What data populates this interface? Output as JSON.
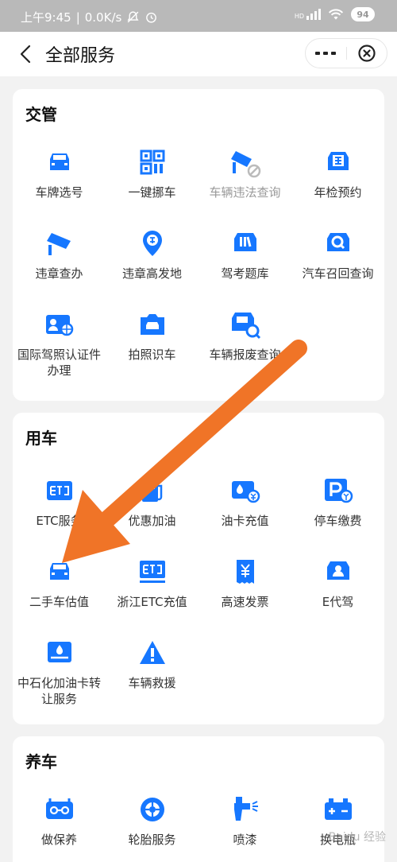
{
  "status_bar": {
    "time": "上午9:45",
    "separator": "|",
    "speed": "0.0K/s",
    "signal": "HD",
    "battery": "94"
  },
  "header": {
    "title": "全部服务",
    "more_icon": "more-icon",
    "close_icon": "close-circle-icon"
  },
  "sections": {
    "jiaoguan": {
      "title": "交管",
      "items": [
        {
          "label": "车牌选号",
          "icon": "car-front-icon"
        },
        {
          "label": "一键挪车",
          "icon": "qr-code-icon"
        },
        {
          "label": "车辆违法查询",
          "icon": "camera-disabled-icon"
        },
        {
          "label": "年检预约",
          "icon": "car-inspection-icon"
        },
        {
          "label": "违章查办",
          "icon": "surveillance-camera-icon"
        },
        {
          "label": "违章高发地",
          "icon": "location-pin-icon"
        },
        {
          "label": "驾考题库",
          "icon": "book-car-icon"
        },
        {
          "label": "汽车召回查询",
          "icon": "car-search-icon"
        },
        {
          "label": "国际驾照认证件办理",
          "icon": "license-card-icon"
        },
        {
          "label": "拍照识车",
          "icon": "camera-car-icon"
        },
        {
          "label": "车辆报废查询",
          "icon": "scrap-search-icon"
        }
      ]
    },
    "yongche": {
      "title": "用车",
      "items": [
        {
          "label": "ETC服务",
          "icon": "etc-card-icon"
        },
        {
          "label": "优惠加油",
          "icon": "coupon-fuel-icon"
        },
        {
          "label": "油卡充值",
          "icon": "fuel-card-icon"
        },
        {
          "label": "停车缴费",
          "icon": "parking-icon"
        },
        {
          "label": "二手车估值",
          "icon": "car-front-icon"
        },
        {
          "label": "浙江ETC充值",
          "icon": "etc-icon"
        },
        {
          "label": "高速发票",
          "icon": "invoice-icon"
        },
        {
          "label": "E代驾",
          "icon": "driver-icon"
        },
        {
          "label": "中石化加油卡转让服务",
          "icon": "fuel-transfer-icon"
        },
        {
          "label": "车辆救援",
          "icon": "warning-icon"
        }
      ]
    },
    "yangche": {
      "title": "养车",
      "items": [
        {
          "label": "做保养",
          "icon": "maintenance-icon"
        },
        {
          "label": "轮胎服务",
          "icon": "tire-icon"
        },
        {
          "label": "喷漆",
          "icon": "spray-gun-icon"
        },
        {
          "label": "换电瓶",
          "icon": "battery-icon"
        }
      ]
    }
  },
  "watermark": "Baidu 经验",
  "colors": {
    "primary": "#1677ff",
    "arrow": "#f07427",
    "card": "#ffffff",
    "background": "#f2f2f2"
  }
}
